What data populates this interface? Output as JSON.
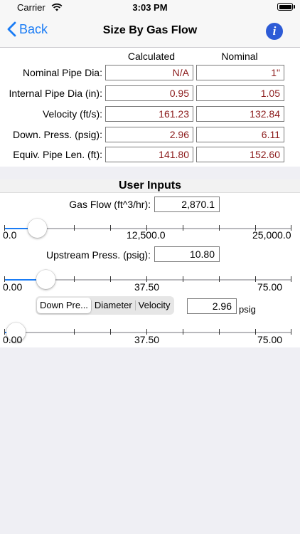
{
  "status": {
    "carrier": "Carrier",
    "time": "3:03 PM"
  },
  "nav": {
    "back": "Back",
    "title": "Size By Gas Flow",
    "info": "i"
  },
  "results": {
    "headers": {
      "calculated": "Calculated",
      "nominal": "Nominal"
    },
    "rows": [
      {
        "label": "Nominal Pipe Dia:",
        "calculated": "N/A",
        "nominal": "1\""
      },
      {
        "label": "Internal Pipe Dia (in):",
        "calculated": "0.95",
        "nominal": "1.05"
      },
      {
        "label": "Velocity (ft/s):",
        "calculated": "161.23",
        "nominal": "132.84"
      },
      {
        "label": "Down. Press. (psig):",
        "calculated": "2.96",
        "nominal": "6.11"
      },
      {
        "label": "Equiv. Pipe Len. (ft):",
        "calculated": "141.80",
        "nominal": "152.60"
      }
    ]
  },
  "inputs": {
    "title": "User Inputs",
    "gas_flow": {
      "label": "Gas Flow (ft^3/hr):",
      "value": "2,870.1",
      "slider_fraction": 0.115,
      "min": "0.0",
      "mid": "12,500.0",
      "max": "25,000.0"
    },
    "upstream": {
      "label": "Upstream Press. (psig):",
      "value": "10.80",
      "slider_fraction": 0.144,
      "min": "0.00",
      "mid": "37.50",
      "max": "75.00"
    },
    "segment": {
      "options": [
        "Down Pre...",
        "Diameter",
        "Velocity"
      ],
      "selected": 0
    },
    "third": {
      "value": "2.96",
      "unit": "psig",
      "slider_fraction": 0.04,
      "min": "0.00",
      "mid": "37.50",
      "max": "75.00"
    }
  },
  "colors": {
    "accent": "#1a7cf5",
    "result_text": "#8b1a1a",
    "background": "#efeff4"
  }
}
